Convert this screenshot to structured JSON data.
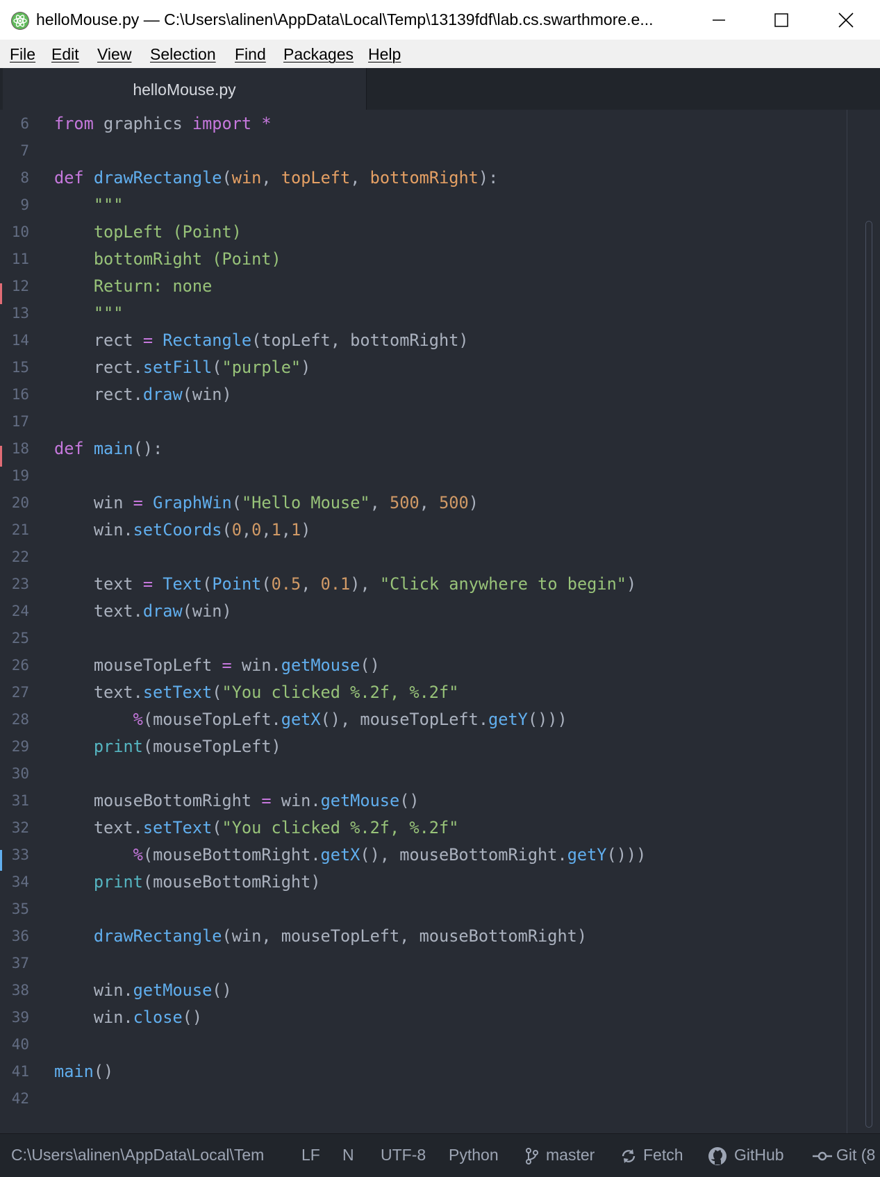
{
  "window": {
    "title": "helloMouse.py — C:\\Users\\alinen\\AppData\\Local\\Temp\\13139fdf\\lab.cs.swarthmore.e...",
    "controls": [
      "minimize-icon",
      "maximize-icon",
      "close-icon"
    ]
  },
  "menu": {
    "items": [
      "File",
      "Edit",
      "View",
      "Selection",
      "Find",
      "Packages",
      "Help"
    ]
  },
  "tabs": [
    {
      "label": "helloMouse.py",
      "active": true
    }
  ],
  "editor": {
    "line_numbers": [
      "6",
      "7",
      "8",
      "9",
      "10",
      "11",
      "12",
      "13",
      "14",
      "15",
      "16",
      "17",
      "18",
      "19",
      "20",
      "21",
      "22",
      "23",
      "24",
      "25",
      "26",
      "27",
      "28",
      "29",
      "30",
      "31",
      "32",
      "33",
      "34",
      "35",
      "36",
      "37",
      "38",
      "39",
      "40",
      "41",
      "42"
    ],
    "lines": [
      "from graphics import *",
      "",
      "def drawRectangle(win, topLeft, bottomRight):",
      "    \"\"\"",
      "    topLeft (Point)",
      "    bottomRight (Point)",
      "    Return: none",
      "    \"\"\"",
      "    rect = Rectangle(topLeft, bottomRight)",
      "    rect.setFill(\"purple\")",
      "    rect.draw(win)",
      "",
      "def main():",
      "",
      "    win = GraphWin(\"Hello Mouse\", 500, 500)",
      "    win.setCoords(0,0,1,1)",
      "",
      "    text = Text(Point(0.5, 0.1), \"Click anywhere to begin\")",
      "    text.draw(win)",
      "",
      "    mouseTopLeft = win.getMouse()",
      "    text.setText(\"You clicked %.2f, %.2f\"",
      "        %(mouseTopLeft.getX(), mouseTopLeft.getY()))",
      "    print(mouseTopLeft)",
      "",
      "    mouseBottomRight = win.getMouse()",
      "    text.setText(\"You clicked %.2f, %.2f\"",
      "        %(mouseBottomRight.getX(), mouseBottomRight.getY()))",
      "    print(mouseBottomRight)",
      "",
      "    drawRectangle(win, mouseTopLeft, mouseBottomRight)",
      "",
      "    win.getMouse()",
      "    win.close()",
      "",
      "main()",
      ""
    ]
  },
  "status": {
    "path": "C:\\Users\\alinen\\AppData\\Local\\Tem",
    "line_ending": "LF",
    "n": "N",
    "encoding": "UTF-8",
    "grammar": "Python",
    "branch": "master",
    "fetch": "Fetch",
    "github": "GitHub",
    "git": "Git (8"
  },
  "colors": {
    "editor_bg": "#282c34",
    "keyword": "#c678dd",
    "function": "#61afef",
    "string": "#98c379",
    "number": "#d19a66",
    "parameter": "#e5a064",
    "builtin": "#56b6c2"
  }
}
